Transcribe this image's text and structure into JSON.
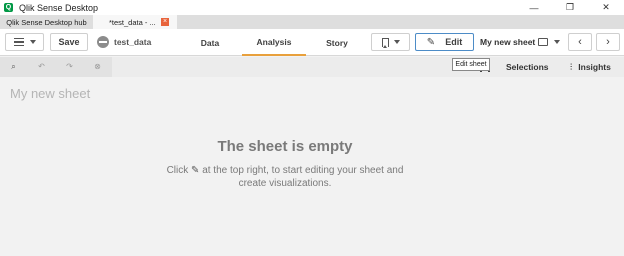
{
  "window": {
    "title": "Qlik Sense Desktop",
    "controls": {
      "minimize": "—",
      "restore": "❐",
      "close": "✕"
    }
  },
  "tabs": [
    {
      "label": "Qlik Sense Desktop hub"
    },
    {
      "label": "*test_data - ..."
    }
  ],
  "toolbar": {
    "save_label": "Save",
    "app_name": "test_data",
    "nav": [
      "Data",
      "Analysis",
      "Story"
    ],
    "active_nav": "Analysis",
    "edit_label": "Edit",
    "sheet_name": "My new sheet",
    "prev_glyph": "‹",
    "next_glyph": "›"
  },
  "subbar": {
    "selections_label": "Selections",
    "insights_label": "Insights"
  },
  "tooltip": "Edit sheet",
  "main": {
    "sheet_title": "My new sheet",
    "empty_title": "The sheet is empty",
    "empty_text_before": "Click",
    "empty_text_after": "at the top right, to start editing your sheet and",
    "empty_text_line2": "create visualizations."
  },
  "colors": {
    "active_tab_underline": "#e8a03c",
    "edit_border": "#4d8cc7",
    "close_tab": "#e8643c",
    "brand": "#009845"
  },
  "icons": [
    "qlik-app-icon",
    "hamburger-icon",
    "globe-icon",
    "bookmark-icon",
    "pencil-icon",
    "sheet-icon",
    "selections-icon",
    "insights-icon"
  ]
}
